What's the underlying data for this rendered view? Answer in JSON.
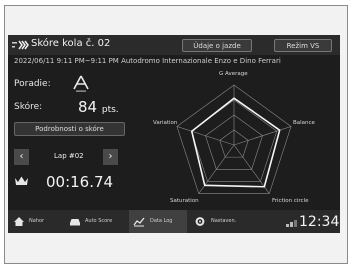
{
  "header": {
    "title": "Skóre kola č. 02",
    "btn_drive_data": "Údaje o jazde",
    "btn_vs_mode": "Režim VS"
  },
  "session": {
    "info": "2022/06/11 9:11 PM~9:11 PM Autodromo Internazionale Enzo e Dino Ferrari"
  },
  "left": {
    "rank_label": "Poradie:",
    "score_label": "Skóre:",
    "score_value": "84",
    "score_unit": "pts.",
    "details_button": "Podrobnosti o skóre",
    "lap_label": "Lap #02",
    "best_time": "00:16.74"
  },
  "radar": {
    "axes": [
      "G Average",
      "Balance",
      "Friction circle",
      "Saturation",
      "Variation"
    ]
  },
  "nav": {
    "items": [
      {
        "label": "Nahor"
      },
      {
        "label": "Auto Score"
      },
      {
        "label": "Data Log"
      },
      {
        "label": "Nastaven."
      }
    ],
    "clock": "12:34"
  },
  "colors": {
    "screen_bg": "#1d1d1d",
    "header_bg": "#2b2b2b",
    "text": "#e8e8e8"
  }
}
